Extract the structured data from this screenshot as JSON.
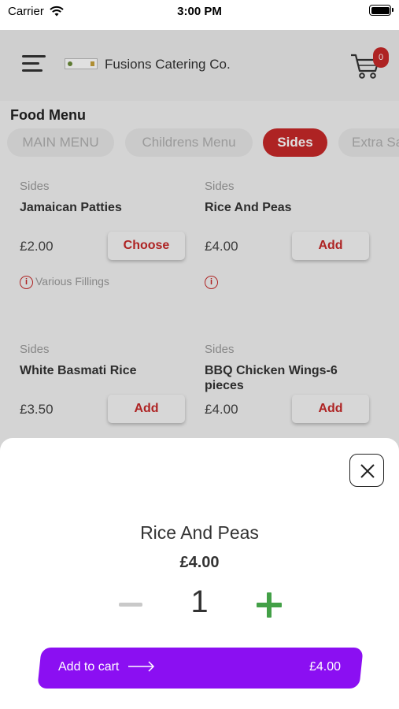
{
  "status_bar": {
    "carrier": "Carrier",
    "time": "3:00 PM"
  },
  "header": {
    "brand": "Fusions Catering Co.",
    "cart_count": "0"
  },
  "menu": {
    "title": "Food Menu",
    "tabs": [
      {
        "label": "MAIN MENU",
        "active": false
      },
      {
        "label": "Childrens Menu",
        "active": false
      },
      {
        "label": "Sides",
        "active": true
      },
      {
        "label": "Extra Sa",
        "active": false
      }
    ],
    "items": [
      {
        "category": "Sides",
        "name": "Jamaican Patties",
        "price": "£2.00",
        "button": "Choose",
        "info": "Various Fillings"
      },
      {
        "category": "Sides",
        "name": "Rice And Peas",
        "price": "£4.00",
        "button": "Add",
        "info": ""
      },
      {
        "category": "Sides",
        "name": "White Basmati Rice",
        "price": "£3.50",
        "button": "Add"
      },
      {
        "category": "Sides",
        "name": "BBQ Chicken Wings-6 pieces",
        "price": "£4.00",
        "button": "Add"
      }
    ]
  },
  "sheet": {
    "title": "Rice And Peas",
    "price": "£4.00",
    "quantity": "1",
    "add_to_cart_label": "Add to cart",
    "add_to_cart_total": "£4.00"
  },
  "colors": {
    "accent": "#c62828",
    "cta": "#8b0ff2",
    "plus": "#43a047"
  }
}
